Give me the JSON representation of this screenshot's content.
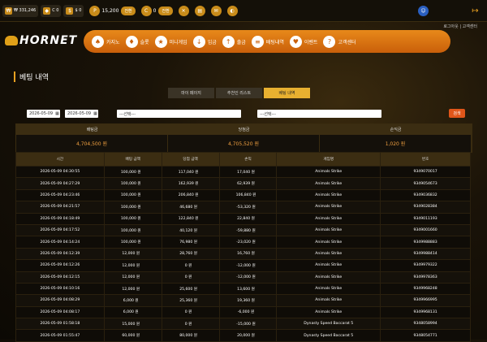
{
  "topbar": {
    "balance1": "₩ 331,246",
    "balance2": "C 0",
    "balance3": "$ 0",
    "points": "15,200",
    "points_btn": "전환",
    "coin": "0",
    "coin_btn": "전환"
  },
  "header": {
    "logo": "HORNET",
    "top_link": "로그아웃 | 고객센터",
    "nav": [
      {
        "label": "카지노",
        "icon": "♠"
      },
      {
        "label": "슬롯",
        "icon": "♦"
      },
      {
        "label": "미니게임",
        "icon": "★"
      },
      {
        "label": "입금",
        "icon": "↓"
      },
      {
        "label": "출금",
        "icon": "↑"
      },
      {
        "label": "배팅내역",
        "icon": "≡"
      },
      {
        "label": "이벤트",
        "icon": "♥"
      },
      {
        "label": "고객센터",
        "icon": "?"
      }
    ]
  },
  "page": {
    "title": "베팅 내역",
    "tabs": [
      "마이 페이지",
      "추천인 리스트",
      "베팅 내역"
    ]
  },
  "filters": {
    "date_from": "2026-05-09",
    "date_to": "2026-05-09",
    "select1": "---선택---",
    "select2": "---선택---",
    "search": "검색"
  },
  "summary": {
    "bet_label": "배팅금",
    "bet_value": "4,704,500 원",
    "win_label": "당첨금",
    "win_value": "4,705,520 원",
    "pl_label": "손익금",
    "pl_value": "1,020 원"
  },
  "table": {
    "headers": [
      "시간",
      "배팅 금액",
      "당첨 금액",
      "손익",
      "게임명",
      "번호"
    ],
    "rows": [
      [
        "2026-05-09 04:30:55",
        "100,000 원",
        "117,040 원",
        "17,040 원",
        "Animals Strike",
        "9349070017"
      ],
      [
        "2026-05-09 04:27:29",
        "100,000 원",
        "162,939 원",
        "62,939 원",
        "Animals Strike",
        "9349054673"
      ],
      [
        "2026-05-09 04:23:46",
        "100,000 원",
        "206,840 원",
        "106,840 원",
        "Animals Strike",
        "9349036832"
      ],
      [
        "2026-05-09 04:21:57",
        "100,000 원",
        "46,680 원",
        "-53,320 원",
        "Animals Strike",
        "9349028384"
      ],
      [
        "2026-05-09 04:18:49",
        "100,000 원",
        "122,840 원",
        "22,840 원",
        "Animals Strike",
        "9349011193"
      ],
      [
        "2026-05-09 04:17:52",
        "100,000 원",
        "40,120 원",
        "-59,880 원",
        "Animals Strike",
        "9349001660"
      ],
      [
        "2026-05-09 04:14:24",
        "100,000 원",
        "76,980 원",
        "-23,020 원",
        "Animals Strike",
        "9349988883"
      ],
      [
        "2026-05-09 04:12:39",
        "12,000 원",
        "28,760 원",
        "16,760 원",
        "Animals Strike",
        "9349988414"
      ],
      [
        "2026-05-09 04:12:26",
        "12,000 원",
        "0 원",
        "-12,000 원",
        "Animals Strike",
        "9349979322"
      ],
      [
        "2026-05-09 04:12:15",
        "12,000 원",
        "0 원",
        "-12,000 원",
        "Animals Strike",
        "9349978363"
      ],
      [
        "2026-05-09 04:10:16",
        "12,000 원",
        "25,600 원",
        "13,600 원",
        "Animals Strike",
        "9349968248"
      ],
      [
        "2026-05-09 04:08:29",
        "6,000 원",
        "25,360 원",
        "19,360 원",
        "Animals Strike",
        "9349966995"
      ],
      [
        "2026-05-09 04:08:17",
        "6,000 원",
        "0 원",
        "-6,000 원",
        "Animals Strike",
        "9349968131"
      ],
      [
        "2026-05-09 01:58:18",
        "15,000 원",
        "0 원",
        "-15,000 원",
        "Dynasty Speed Baccarat 5",
        "9348058994"
      ],
      [
        "2026-05-09 01:55:47",
        "60,000 원",
        "80,000 원",
        "20,000 원",
        "Dynasty Speed Baccarat 5",
        "9348054771"
      ]
    ]
  }
}
